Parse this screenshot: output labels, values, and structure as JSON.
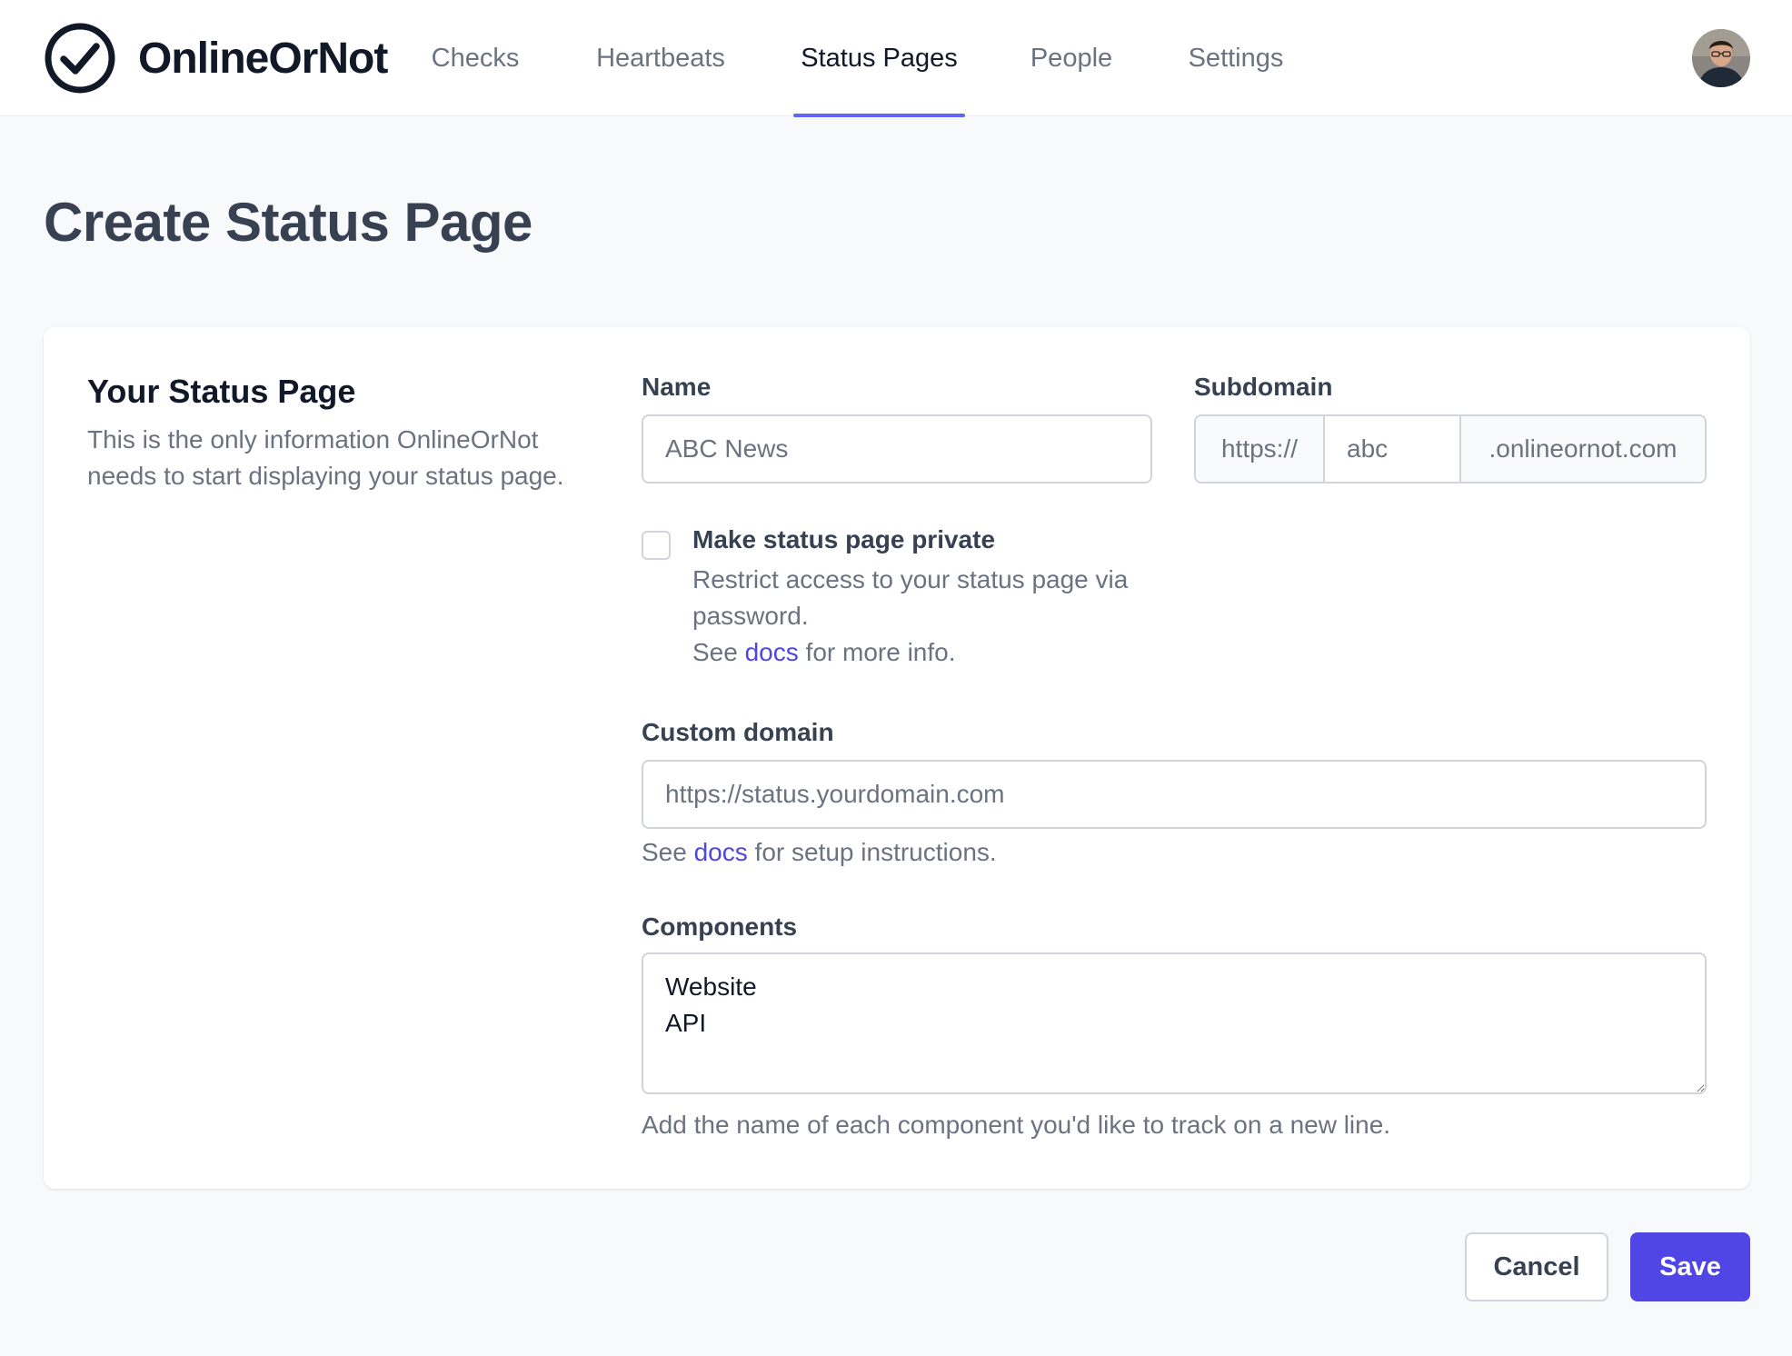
{
  "app": {
    "name": "OnlineOrNot",
    "logo_icon": "check-circle-icon"
  },
  "nav": {
    "items": [
      {
        "label": "Checks",
        "active": false
      },
      {
        "label": "Heartbeats",
        "active": false
      },
      {
        "label": "Status Pages",
        "active": true
      },
      {
        "label": "People",
        "active": false
      },
      {
        "label": "Settings",
        "active": false
      }
    ],
    "avatar_icon": "user-avatar-icon"
  },
  "page": {
    "title": "Create Status Page"
  },
  "card": {
    "title": "Your Status Page",
    "description": "This is the only information OnlineOrNot needs to start displaying your status page."
  },
  "form": {
    "name": {
      "label": "Name",
      "value": "",
      "placeholder": "ABC News"
    },
    "subdomain": {
      "label": "Subdomain",
      "prefix": "https://",
      "value": "",
      "placeholder": "abc",
      "suffix": ".onlineornot.com"
    },
    "private": {
      "checked": false,
      "title": "Make status page private",
      "desc": "Restrict access to your status page via password.",
      "docs_pre": "See ",
      "docs_link": "docs",
      "docs_post": " for more info."
    },
    "custom_domain": {
      "label": "Custom domain",
      "value": "",
      "placeholder": "https://status.yourdomain.com",
      "help_pre": "See ",
      "help_link": "docs",
      "help_post": " for setup instructions."
    },
    "components": {
      "label": "Components",
      "value": "Website\nAPI",
      "help": "Add the name of each component you'd like to track on a new line."
    }
  },
  "actions": {
    "cancel_label": "Cancel",
    "save_label": "Save"
  },
  "colors": {
    "accent": "#4f46e5",
    "nav_underline": "#6366f1",
    "background": "#f8f9fb"
  }
}
